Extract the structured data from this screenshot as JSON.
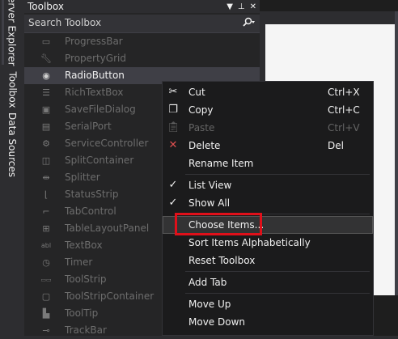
{
  "side_tabs": [
    "Server Explorer",
    "Toolbox",
    "Data Sources"
  ],
  "toolbox": {
    "title": "Toolbox",
    "title_icons": [
      "▼",
      "⊥",
      "✕"
    ],
    "search_placeholder": "Search Toolbox",
    "items": [
      {
        "label": "ProgressBar",
        "icon": "progressbar-icon"
      },
      {
        "label": "PropertyGrid",
        "icon": "wrench-icon"
      },
      {
        "label": "RadioButton",
        "icon": "radio-icon",
        "selected": true
      },
      {
        "label": "RichTextBox",
        "icon": "richtextbox-icon"
      },
      {
        "label": "SaveFileDialog",
        "icon": "savefiledialog-icon"
      },
      {
        "label": "SerialPort",
        "icon": "serialport-icon"
      },
      {
        "label": "ServiceController",
        "icon": "gear-icon"
      },
      {
        "label": "SplitContainer",
        "icon": "splitcontainer-icon"
      },
      {
        "label": "Splitter",
        "icon": "splitter-icon"
      },
      {
        "label": "StatusStrip",
        "icon": "statusstrip-icon"
      },
      {
        "label": "TabControl",
        "icon": "tabcontrol-icon"
      },
      {
        "label": "TableLayoutPanel",
        "icon": "table-icon"
      },
      {
        "label": "TextBox",
        "icon": "textbox-icon"
      },
      {
        "label": "Timer",
        "icon": "timer-icon"
      },
      {
        "label": "ToolStrip",
        "icon": "toolstrip-icon"
      },
      {
        "label": "ToolStripContainer",
        "icon": "toolstripcontainer-icon"
      },
      {
        "label": "ToolTip",
        "icon": "tooltip-icon"
      },
      {
        "label": "TrackBar",
        "icon": "trackbar-icon"
      }
    ]
  },
  "context_menu": {
    "cut": {
      "label": "Cut",
      "shortcut": "Ctrl+X"
    },
    "copy": {
      "label": "Copy",
      "shortcut": "Ctrl+C"
    },
    "paste": {
      "label": "Paste",
      "shortcut": "Ctrl+V"
    },
    "delete": {
      "label": "Delete",
      "shortcut": "Del"
    },
    "rename": {
      "label": "Rename Item"
    },
    "list_view": {
      "label": "List View"
    },
    "show_all": {
      "label": "Show All"
    },
    "choose_items": {
      "label": "Choose Items..."
    },
    "sort": {
      "label": "Sort Items Alphabetically"
    },
    "reset": {
      "label": "Reset Toolbox"
    },
    "add_tab": {
      "label": "Add Tab"
    },
    "move_up": {
      "label": "Move Up"
    },
    "move_down": {
      "label": "Move Down"
    }
  },
  "colors": {
    "highlight_box": "#e0101a",
    "delete_icon": "#e05050"
  }
}
